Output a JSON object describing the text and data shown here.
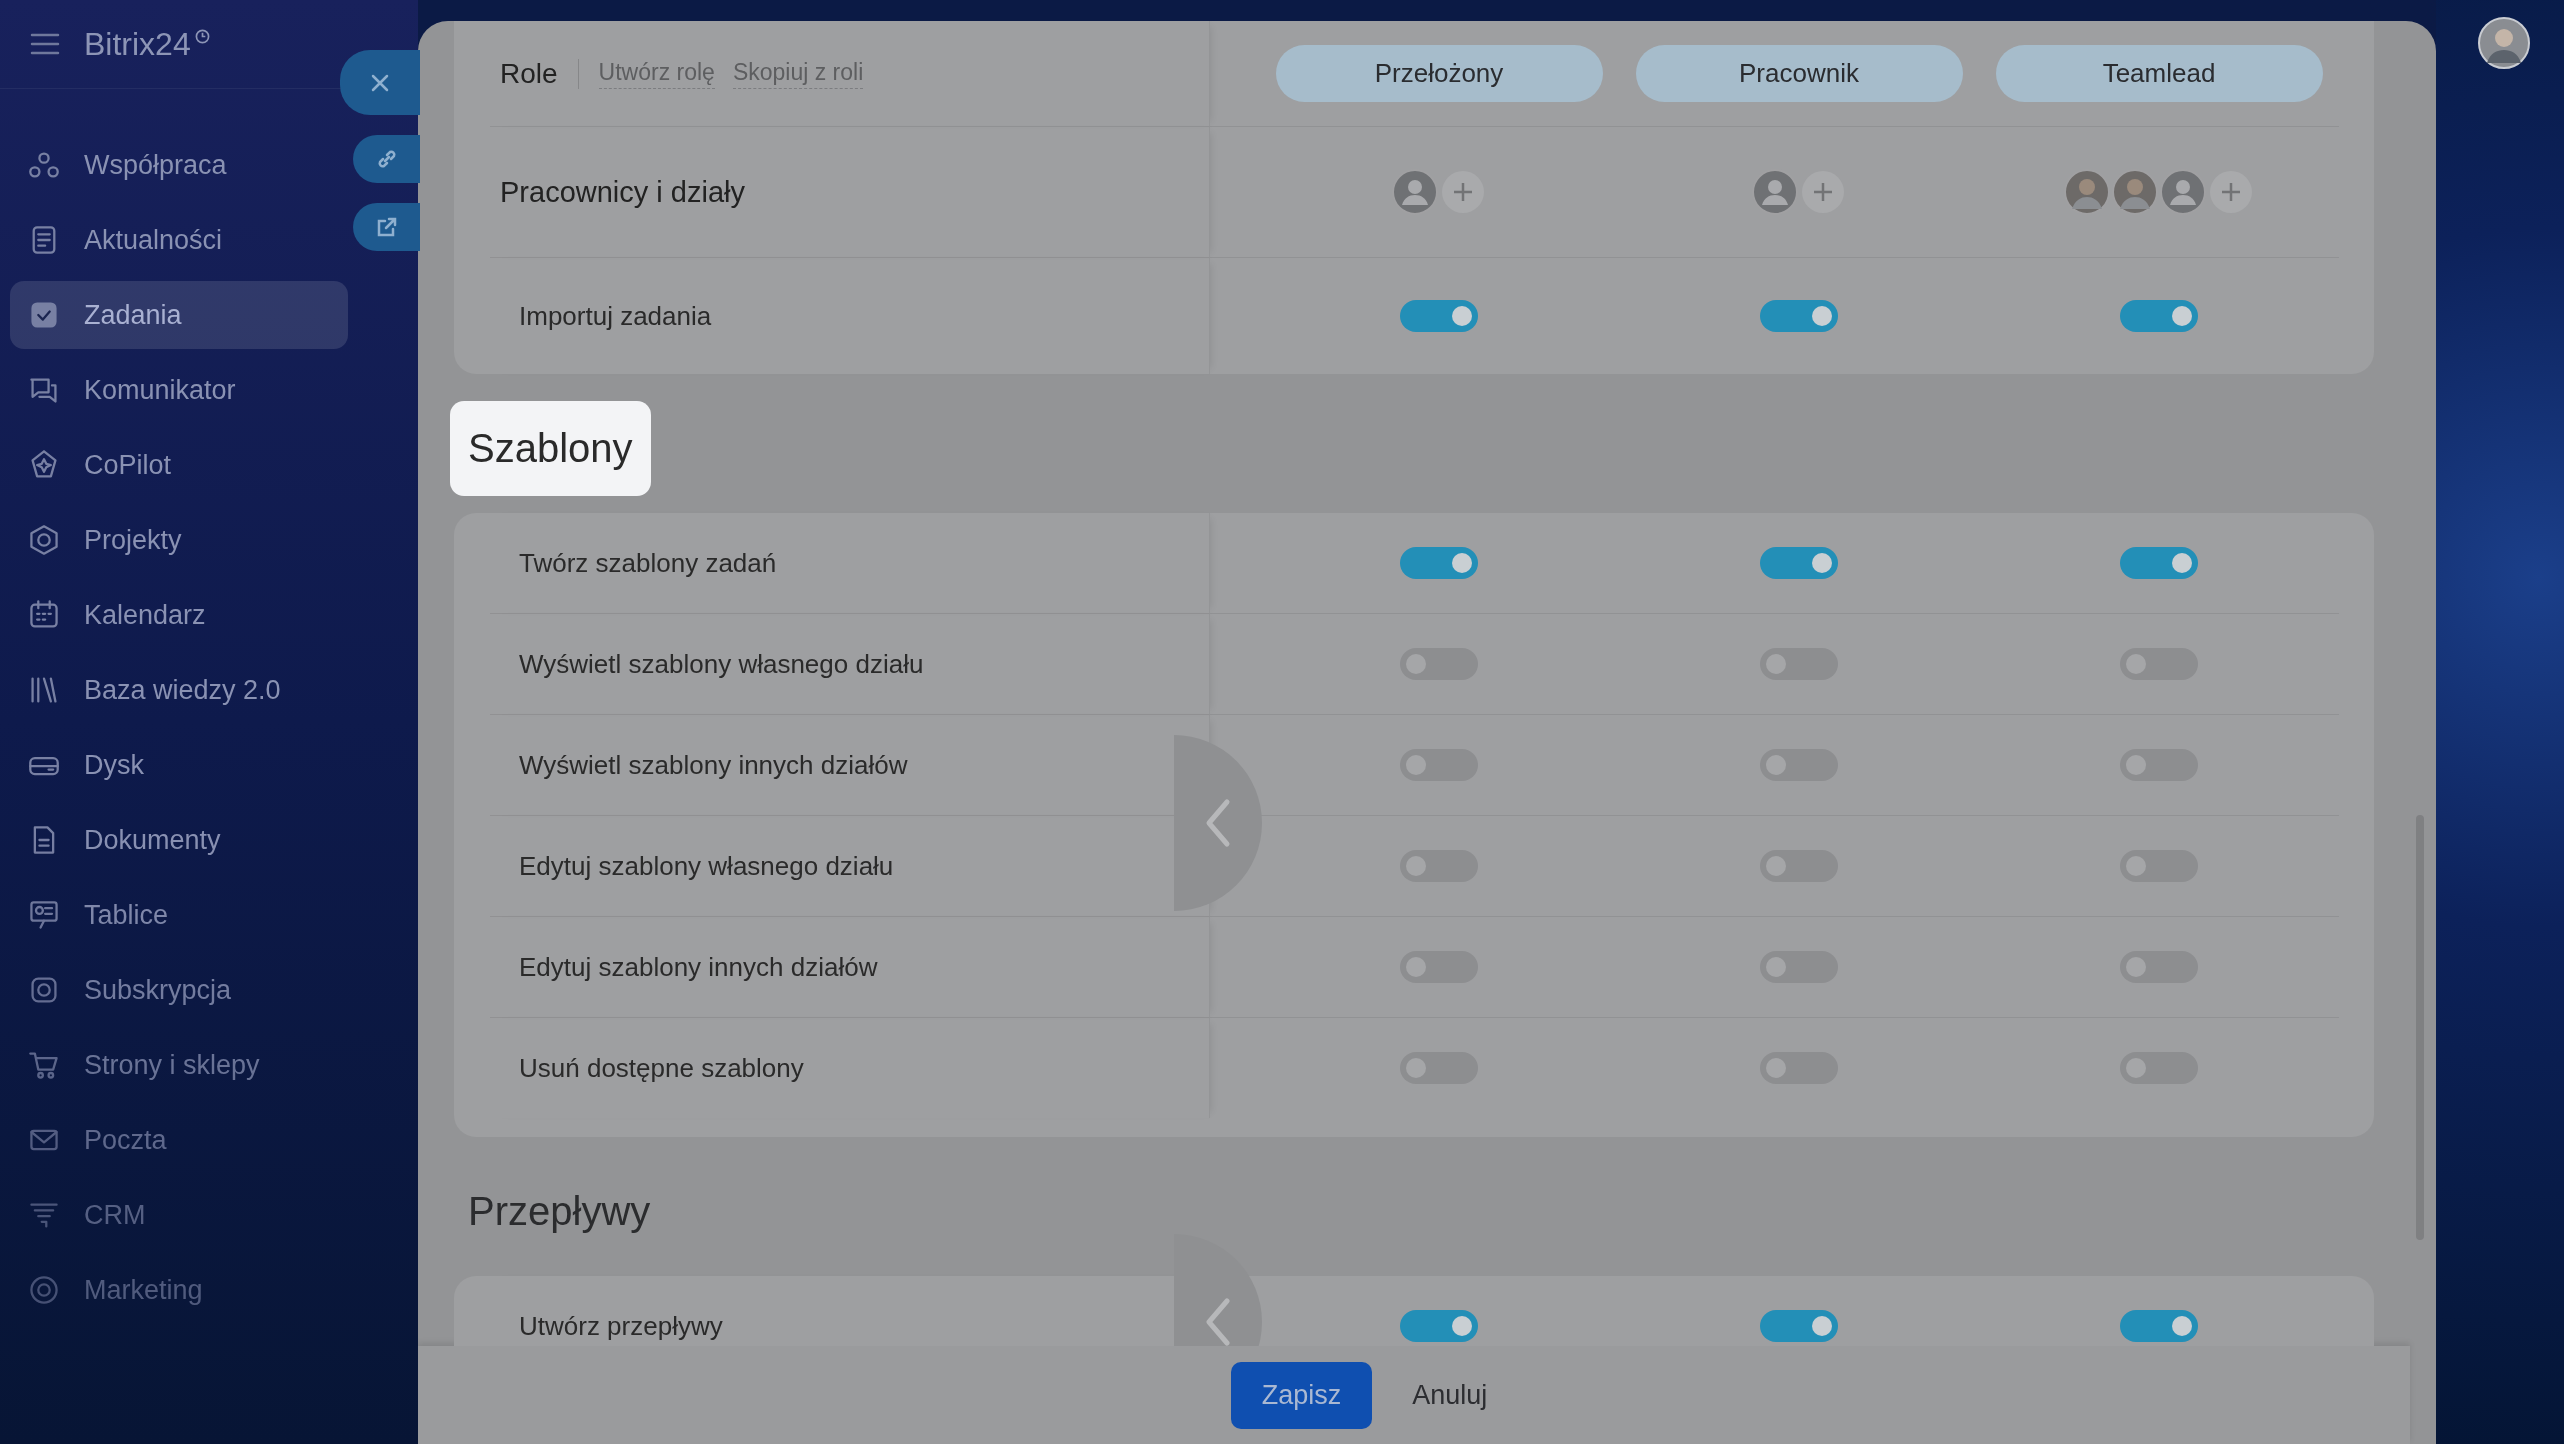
{
  "sidebar": {
    "title": "Bitrix24",
    "items": [
      {
        "label": "Współpraca",
        "selected": false
      },
      {
        "label": "Aktualności",
        "selected": false
      },
      {
        "label": "Zadania",
        "selected": true
      },
      {
        "label": "Komunikator",
        "selected": false
      },
      {
        "label": "CoPilot",
        "selected": false
      },
      {
        "label": "Projekty",
        "selected": false
      },
      {
        "label": "Kalendarz",
        "selected": false
      },
      {
        "label": "Baza wiedzy 2.0",
        "selected": false
      },
      {
        "label": "Dysk",
        "selected": false
      },
      {
        "label": "Dokumenty",
        "selected": false
      },
      {
        "label": "Tablice",
        "selected": false
      },
      {
        "label": "Subskrypcja",
        "selected": false
      },
      {
        "label": "Strony i sklepy",
        "selected": false
      },
      {
        "label": "Poczta",
        "selected": false
      },
      {
        "label": "CRM",
        "selected": false
      },
      {
        "label": "Marketing",
        "selected": false
      }
    ]
  },
  "role_table": {
    "header": "Role",
    "actions": [
      "Utwórz rolę",
      "Skopiuj z roli"
    ],
    "roles": [
      "Przełożony",
      "Pracownik",
      "Teamlead"
    ],
    "assignees_label": "Pracownicy i działy",
    "assignees": [
      [
        {
          "kind": "placeholder"
        }
      ],
      [
        {
          "kind": "placeholder"
        }
      ],
      [
        {
          "kind": "photo"
        },
        {
          "kind": "photo"
        },
        {
          "kind": "placeholder"
        }
      ]
    ],
    "rows": [
      {
        "label": "Importuj zadania",
        "values": [
          true,
          true,
          true
        ]
      }
    ]
  },
  "sections": [
    {
      "title": "Szablony",
      "highlighted": true,
      "rows": [
        {
          "label": "Twórz szablony zadań",
          "values": [
            true,
            true,
            true
          ]
        },
        {
          "label": "Wyświetl szablony własnego działu",
          "values": [
            false,
            false,
            false
          ]
        },
        {
          "label": "Wyświetl szablony innych działów",
          "values": [
            false,
            false,
            false
          ]
        },
        {
          "label": "Edytuj szablony własnego działu",
          "values": [
            false,
            false,
            false
          ]
        },
        {
          "label": "Edytuj szablony innych działów",
          "values": [
            false,
            false,
            false
          ]
        },
        {
          "label": "Usuń dostępne szablony",
          "values": [
            false,
            false,
            false
          ]
        }
      ]
    },
    {
      "title": "Przepływy",
      "highlighted": false,
      "rows": [
        {
          "label": "Utwórz przepływy",
          "values": [
            true,
            true,
            true
          ]
        }
      ]
    }
  ],
  "footer": {
    "buttons": [
      {
        "label": "Zapisz",
        "kind": "primary"
      },
      {
        "label": "Anuluj",
        "kind": "link"
      }
    ]
  }
}
